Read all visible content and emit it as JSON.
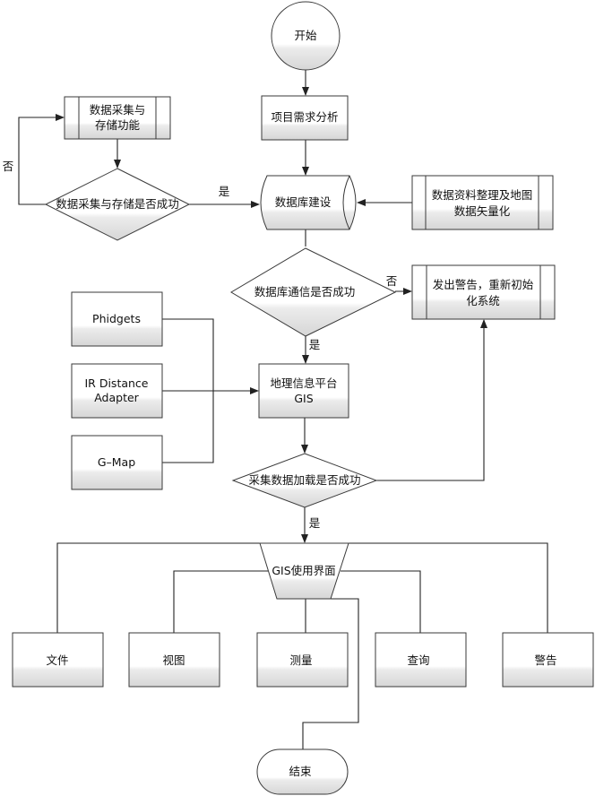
{
  "diagram": {
    "nodes": {
      "start": "开始",
      "requirements": "项目需求分析",
      "collect_store": [
        "数据采集与",
        "存储功能"
      ],
      "collect_decision": "数据采集与存储是否成功",
      "database": "数据库建设",
      "data_vector": [
        "数据资料整理及地图",
        "数据矢量化"
      ],
      "db_comm_decision": "数据库通信是否成功",
      "warn_reinit": [
        "发出警告，重新初始",
        "化系统"
      ],
      "phidgets": "Phidgets",
      "ir_adapter": [
        "IR Distance",
        "Adapter"
      ],
      "gmap": "G–Map",
      "gis_platform": [
        "地理信息平台",
        "GIS"
      ],
      "load_decision": "采集数据加载是否成功",
      "gis_ui": "GIS使用界面",
      "file": "文件",
      "view": "视图",
      "measure": "测量",
      "query": "查询",
      "alert": "警告",
      "end": "结束"
    },
    "edge_labels": {
      "collect_no": "否",
      "collect_yes": "是",
      "db_no": "否",
      "db_yes": "是",
      "load_yes": "是"
    },
    "colors": {
      "stroke": "#3a3a3a",
      "fill_top": "#ffffff",
      "fill_bottom": "#d8d8d8"
    }
  }
}
